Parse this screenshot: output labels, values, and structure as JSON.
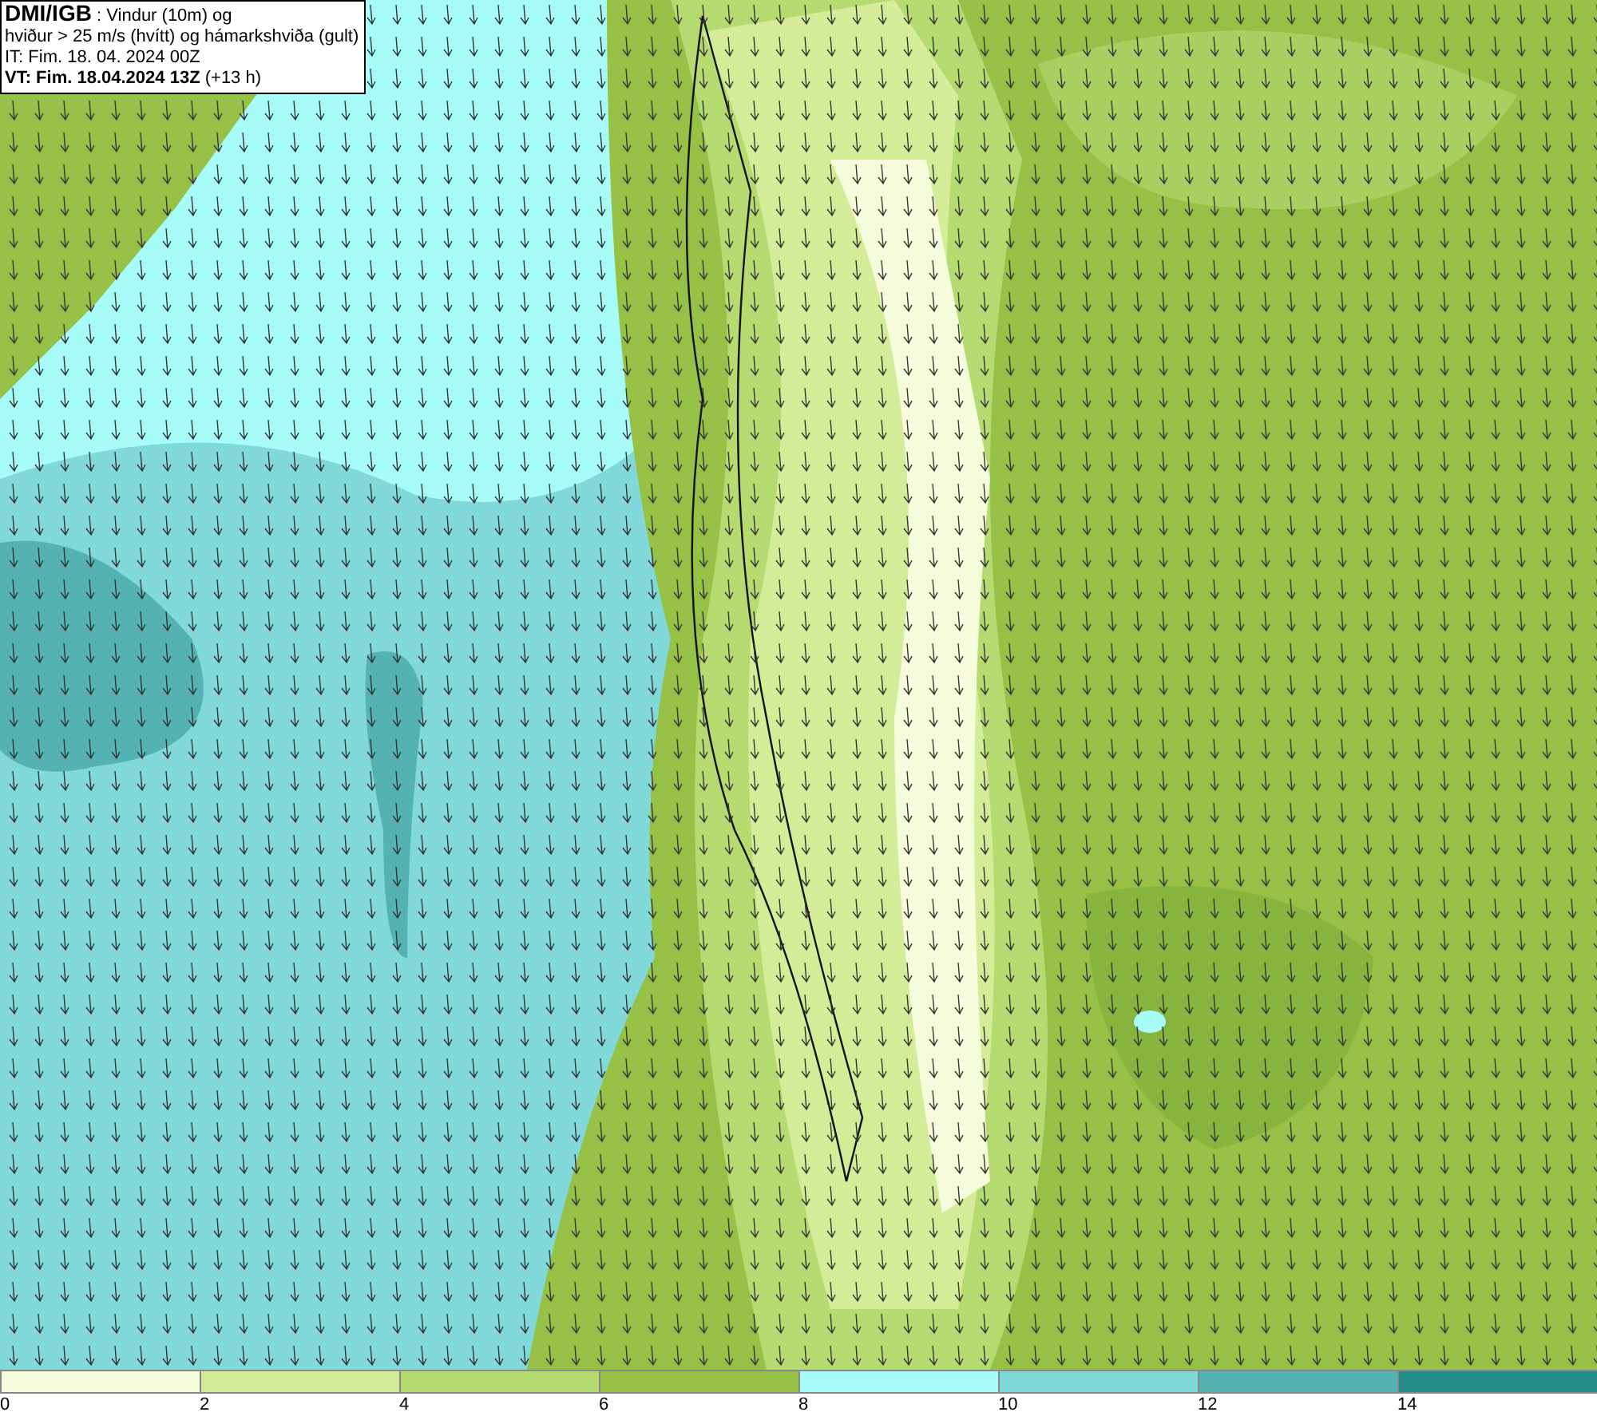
{
  "info_box": {
    "lines": [
      "**DMI/IGB** : Vindur (10m) og",
      "hviður > 25 m/s (hvítt) og hámarkshviða (gult)",
      "IT: Fim. 18. 04. 2024 00Z",
      "**VT: Fim. 18.04.2024 13Z** (+13 h)"
    ]
  },
  "legend": {
    "bins": [
      {
        "color": "#f4fcdc"
      },
      {
        "color": "#d4ec98"
      },
      {
        "color": "#b4da70"
      },
      {
        "color": "#96c046"
      },
      {
        "color": "#a8fcf8"
      },
      {
        "color": "#80d8d8"
      },
      {
        "color": "#54b2b2"
      },
      {
        "color": "#248c88"
      }
    ],
    "ticks": [
      "0",
      "2",
      "4",
      "6",
      "8",
      "10",
      "12",
      "14"
    ]
  }
}
